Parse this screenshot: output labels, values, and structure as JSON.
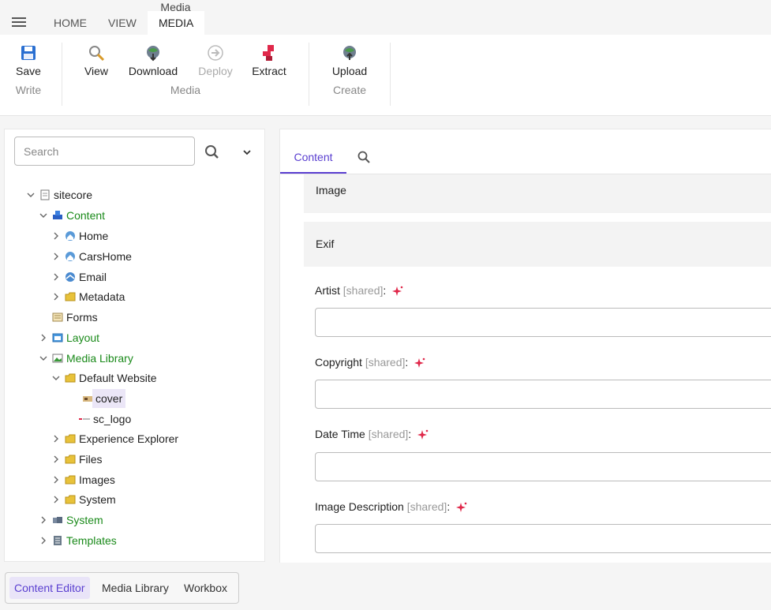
{
  "top_tabs": {
    "context_label": "Media",
    "tabs": [
      {
        "label": "HOME"
      },
      {
        "label": "VIEW"
      },
      {
        "label": "MEDIA"
      }
    ]
  },
  "ribbon": {
    "save": "Save",
    "write_group": "Write",
    "view": "View",
    "download": "Download",
    "deploy": "Deploy",
    "extract": "Extract",
    "media_group": "Media",
    "upload": "Upload",
    "create_group": "Create"
  },
  "tree": {
    "search_placeholder": "Search",
    "items": [
      {
        "label": "sitecore"
      },
      {
        "label": "Content"
      },
      {
        "label": "Home"
      },
      {
        "label": "CarsHome"
      },
      {
        "label": "Email"
      },
      {
        "label": "Metadata"
      },
      {
        "label": "Forms"
      },
      {
        "label": "Layout"
      },
      {
        "label": "Media Library"
      },
      {
        "label": "Default Website"
      },
      {
        "label": "cover"
      },
      {
        "label": "sc_logo"
      },
      {
        "label": "Experience Explorer"
      },
      {
        "label": "Files"
      },
      {
        "label": "Images"
      },
      {
        "label": "System"
      },
      {
        "label": "System"
      },
      {
        "label": "Templates"
      }
    ]
  },
  "content": {
    "tab_label": "Content",
    "sections": [
      {
        "title": "Image"
      },
      {
        "title": "Exif"
      }
    ],
    "fields": [
      {
        "name": "Artist",
        "shared": "[shared]",
        "suffix": ":"
      },
      {
        "name": "Copyright",
        "shared": "[shared]",
        "suffix": ":"
      },
      {
        "name": "Date Time",
        "shared": "[shared]",
        "suffix": ":"
      },
      {
        "name": "Image Description",
        "shared": "[shared]",
        "suffix": ":"
      }
    ]
  },
  "bottom_switch": {
    "items": [
      {
        "label": "Content Editor"
      },
      {
        "label": "Media Library"
      },
      {
        "label": "Workbox"
      }
    ]
  },
  "colors": {
    "accent": "#5a3fd0",
    "tree_green": "#1a8a1a",
    "spark_red": "#e0284a"
  }
}
